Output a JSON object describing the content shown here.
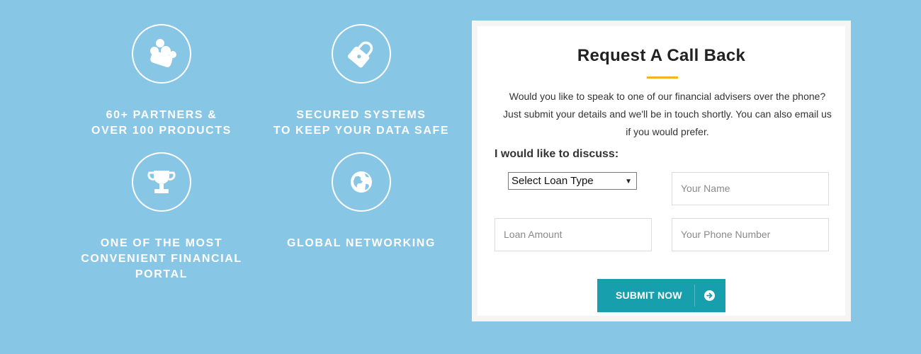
{
  "features": [
    {
      "icon": "partners-icon",
      "lines": [
        "60+ PARTNERS &",
        "OVER 100 PRODUCTS"
      ]
    },
    {
      "icon": "lock-icon",
      "lines": [
        "SECURED SYSTEMS",
        "TO KEEP YOUR DATA SAFE"
      ]
    },
    {
      "icon": "trophy-icon",
      "lines": [
        "ONE OF THE MOST",
        "CONVENIENT FINANCIAL",
        "PORTAL"
      ]
    },
    {
      "icon": "globe-icon",
      "lines": [
        "GLOBAL NETWORKING"
      ]
    }
  ],
  "callback_form": {
    "title": "Request A Call Back",
    "description_lines": [
      "Would you like to speak to one of our financial advisers over the phone?",
      "Just submit your details and we'll be in touch shortly. You can also email us",
      "if you would prefer."
    ],
    "discuss_label": "I would like to discuss:",
    "loan_type_selected": "Select Loan Type",
    "name_placeholder": "Your Name",
    "loan_amount_placeholder": "Loan Amount",
    "phone_placeholder": "Your Phone Number",
    "submit_label": "SUBMIT NOW"
  },
  "colors": {
    "background": "#88c6e6",
    "accent_underline": "#f3b41c",
    "button": "#179fad"
  }
}
